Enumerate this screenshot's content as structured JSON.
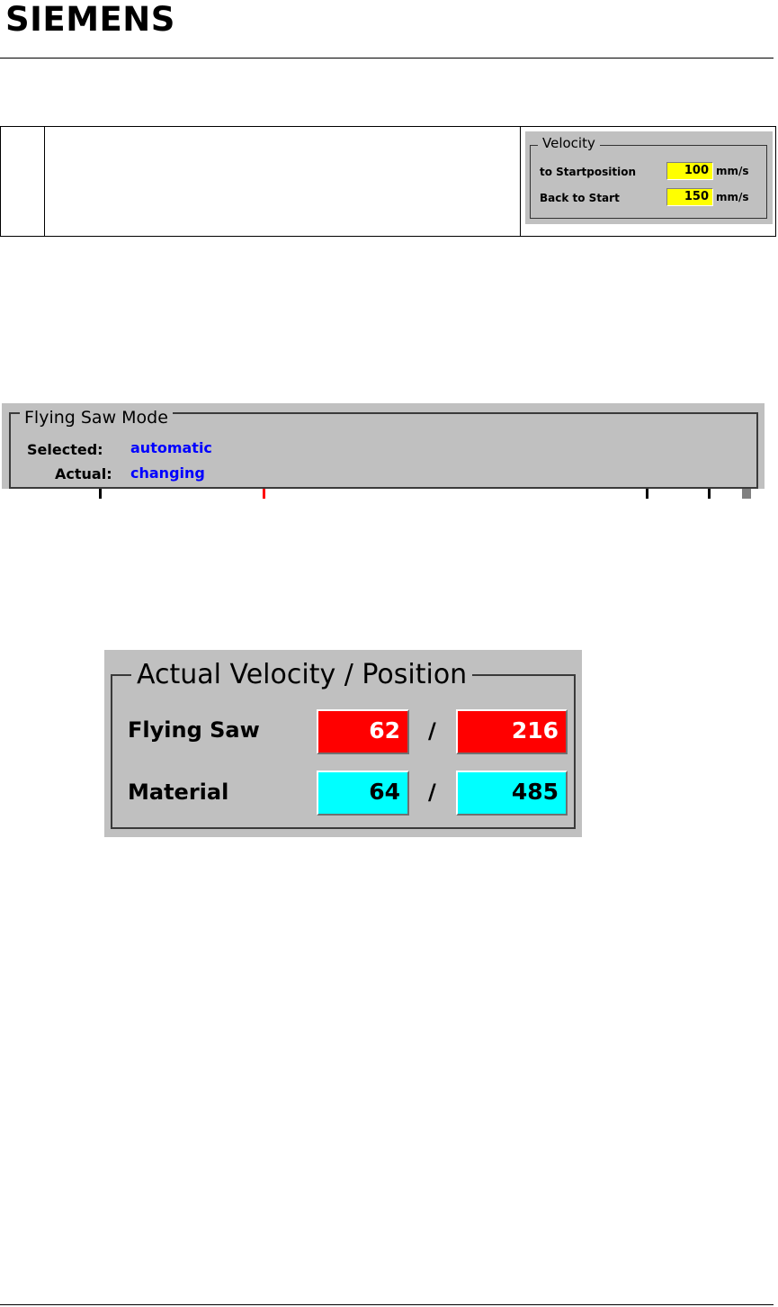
{
  "header": {
    "logo": "SIEMENS"
  },
  "velocity_panel": {
    "title": "Velocity",
    "rows": [
      {
        "label": "to Startposition",
        "value": "100",
        "unit": "mm/s"
      },
      {
        "label": "Back to Start",
        "value": "150",
        "unit": "mm/s"
      }
    ],
    "field_color": "#ffff00"
  },
  "flying_saw_mode": {
    "title": "Flying Saw Mode",
    "selected_label": "Selected:",
    "selected_value": "automatic",
    "actual_label": "Actual:",
    "actual_value": "changing",
    "value_color": "#0000ff"
  },
  "actual_velocity_position": {
    "title": "Actual Velocity / Position",
    "separator": "/",
    "rows": [
      {
        "label": "Flying Saw",
        "velocity": "62",
        "position": "216",
        "color": "#ff0000"
      },
      {
        "label": "Material",
        "velocity": "64",
        "position": "485",
        "color": "#00ffff"
      }
    ]
  }
}
